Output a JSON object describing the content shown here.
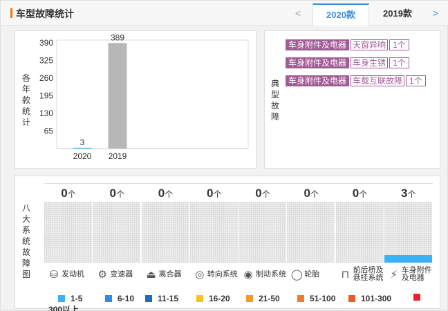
{
  "header": {
    "title": "车型故障统计",
    "prev": "<",
    "next": ">",
    "tabs": [
      {
        "label": "2020款",
        "active": true
      },
      {
        "label": "2019款",
        "active": false
      }
    ]
  },
  "year_panel": {
    "side_label": [
      "各",
      "年",
      "款",
      "统",
      "计"
    ]
  },
  "chart_data": {
    "type": "bar",
    "categories": [
      "2020",
      "2019"
    ],
    "values": [
      3,
      389
    ],
    "data_labels": [
      "3",
      "389"
    ],
    "yticks": [
      65,
      130,
      195,
      260,
      325,
      390
    ],
    "ylim": [
      0,
      400
    ],
    "colors": {
      "2020": "#38b1f5",
      "2019": "#b7b7b7"
    },
    "grid": false
  },
  "typical_panel": {
    "side_label": [
      "典",
      "型",
      "故",
      "障"
    ],
    "faults": [
      {
        "category": "车身附件及电器",
        "name": "天窗异响",
        "count": "1个"
      },
      {
        "category": "车身附件及电器",
        "name": "车身生锈",
        "count": "1个"
      },
      {
        "category": "车身附件及电器",
        "name": "车载互联故障",
        "count": "1个"
      }
    ]
  },
  "systems_panel": {
    "side_label": [
      "八",
      "大",
      "系",
      "统",
      "故",
      "障",
      "图"
    ],
    "unit": "个",
    "systems": [
      {
        "name": "发动机",
        "count": "0",
        "level": 0,
        "icon": "engine-icon",
        "glyph": "⛁"
      },
      {
        "name": "变速器",
        "count": "0",
        "level": 0,
        "icon": "gearbox-icon",
        "glyph": "⚙"
      },
      {
        "name": "离合器",
        "count": "0",
        "level": 0,
        "icon": "clutch-icon",
        "glyph": "⏏"
      },
      {
        "name": "转向系统",
        "count": "0",
        "level": 0,
        "icon": "steering-wheel-icon",
        "glyph": "◎"
      },
      {
        "name": "制动系统",
        "count": "0",
        "level": 0,
        "icon": "brake-icon",
        "glyph": "◉"
      },
      {
        "name": "轮胎",
        "count": "0",
        "level": 0,
        "icon": "tire-icon",
        "glyph": "◯"
      },
      {
        "name": "前后桥及悬挂系统",
        "count": "0",
        "level": 0,
        "icon": "suspension-icon",
        "glyph": "⊓",
        "lines": [
          "前后桥及",
          "悬挂系统"
        ]
      },
      {
        "name": "车身附件及电器",
        "count": "3",
        "level": 0.12,
        "icon": "body-electrics-icon",
        "glyph": "⚡",
        "lines": [
          "车身附件",
          "及电器"
        ]
      }
    ]
  },
  "legend": [
    {
      "label": "1-5",
      "color": "#38b1f5"
    },
    {
      "label": "6-10",
      "color": "#2a8cef"
    },
    {
      "label": "11-15",
      "color": "#1a6fc0"
    },
    {
      "label": "16-20",
      "color": "#f8c21c"
    },
    {
      "label": "21-50",
      "color": "#f59a2a"
    },
    {
      "label": "51-100",
      "color": "#f47a23"
    },
    {
      "label": "101-300",
      "color": "#f05a1e"
    },
    {
      "label": "300以上",
      "color": "#e8212a"
    }
  ]
}
